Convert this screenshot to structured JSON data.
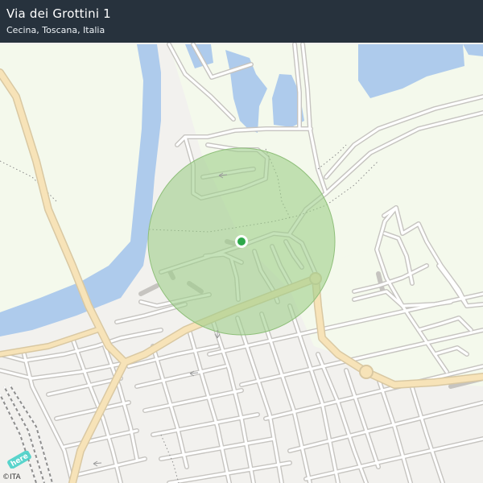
{
  "header": {
    "title": "Via dei Grottini 1",
    "subtitle": "Cecina, Toscana, Italia"
  },
  "map": {
    "marker": {
      "label": "location-marker"
    }
  },
  "branding": {
    "logo_text": "here",
    "copyright": "©ITA"
  },
  "colors": {
    "header_bg": "#1b2733",
    "water": "#aecbec",
    "park": "#f4f9ec",
    "main_road": "#f7e3b8",
    "accuracy_circle": "#9fce8a",
    "marker": "#2ea84a"
  }
}
